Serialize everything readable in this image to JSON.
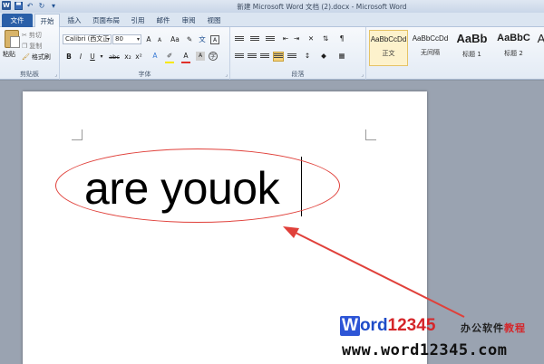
{
  "window": {
    "title": "新建 Microsoft Word 文档 (2).docx - Microsoft Word",
    "app_icon": "W"
  },
  "tabs": [
    {
      "label": "文件"
    },
    {
      "label": "开始"
    },
    {
      "label": "插入"
    },
    {
      "label": "页面布局"
    },
    {
      "label": "引用"
    },
    {
      "label": "邮件"
    },
    {
      "label": "审阅"
    },
    {
      "label": "视图"
    }
  ],
  "clipboard": {
    "paste": "粘贴",
    "cut": "剪切",
    "copy": "复制",
    "format_painter": "格式刷",
    "group_label": "剪贴板"
  },
  "font": {
    "name": "Calibri (西文正",
    "size": "80",
    "group_label": "字体",
    "grow": "A",
    "shrink": "A",
    "change_case": "Aa",
    "bold": "B",
    "italic": "I",
    "underline": "U",
    "strike": "abc",
    "subscript": "x₂",
    "superscript": "x²",
    "font_color": "A",
    "highlight_color": "#f7e800",
    "font_color_value": "#e0302a"
  },
  "paragraph": {
    "group_label": "段落"
  },
  "styles": [
    {
      "sample": "AaBbCcDd",
      "name": "正文"
    },
    {
      "sample": "AaBbCcDd",
      "name": "无间隔"
    },
    {
      "sample": "AaBb",
      "name": "标题 1"
    },
    {
      "sample": "AaBbC",
      "name": "标题 2"
    },
    {
      "sample": "A",
      "name": ""
    }
  ],
  "document": {
    "text": "are youok"
  },
  "annotation": {
    "color": "#e0403a"
  },
  "watermark": {
    "logo_w": "W",
    "logo_text": "ord",
    "logo_num": "12345",
    "cn_a": "办公软件",
    "cn_b": "教程",
    "url": "www.word12345.com"
  }
}
